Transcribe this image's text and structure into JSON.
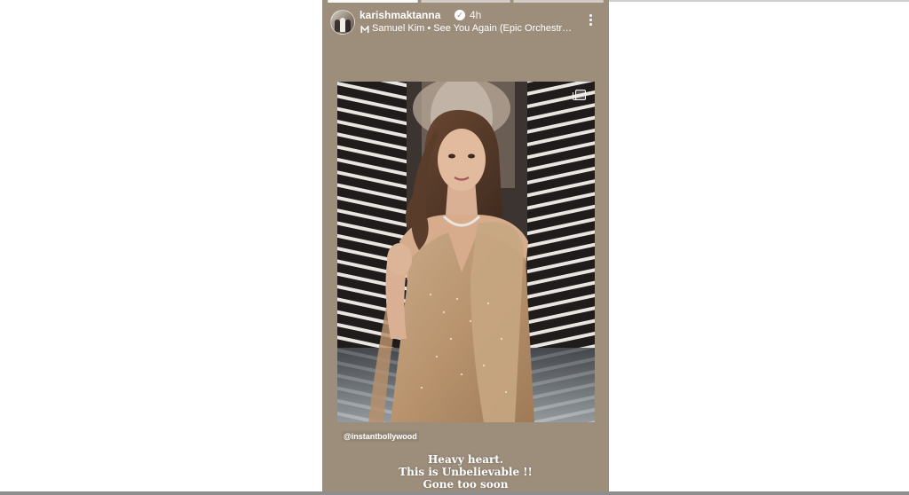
{
  "story": {
    "username": "karishmaktanna",
    "time_ago": "4h",
    "music": "Samuel Kim • See You Again (Epic Orchestr…",
    "mention": "@instantbollywood",
    "caption": [
      "Heavy heart.",
      "This is Unbelievable !!",
      "Gone too soon"
    ],
    "progress_segments": 3,
    "active_segment": 0,
    "icons": {
      "verified": "verified-badge-icon",
      "music": "music-note-icon",
      "more": "more-options-icon",
      "multi": "copy-multiple-icon"
    },
    "colors": {
      "background": "#9d8e7c",
      "text": "#ffffff"
    }
  }
}
